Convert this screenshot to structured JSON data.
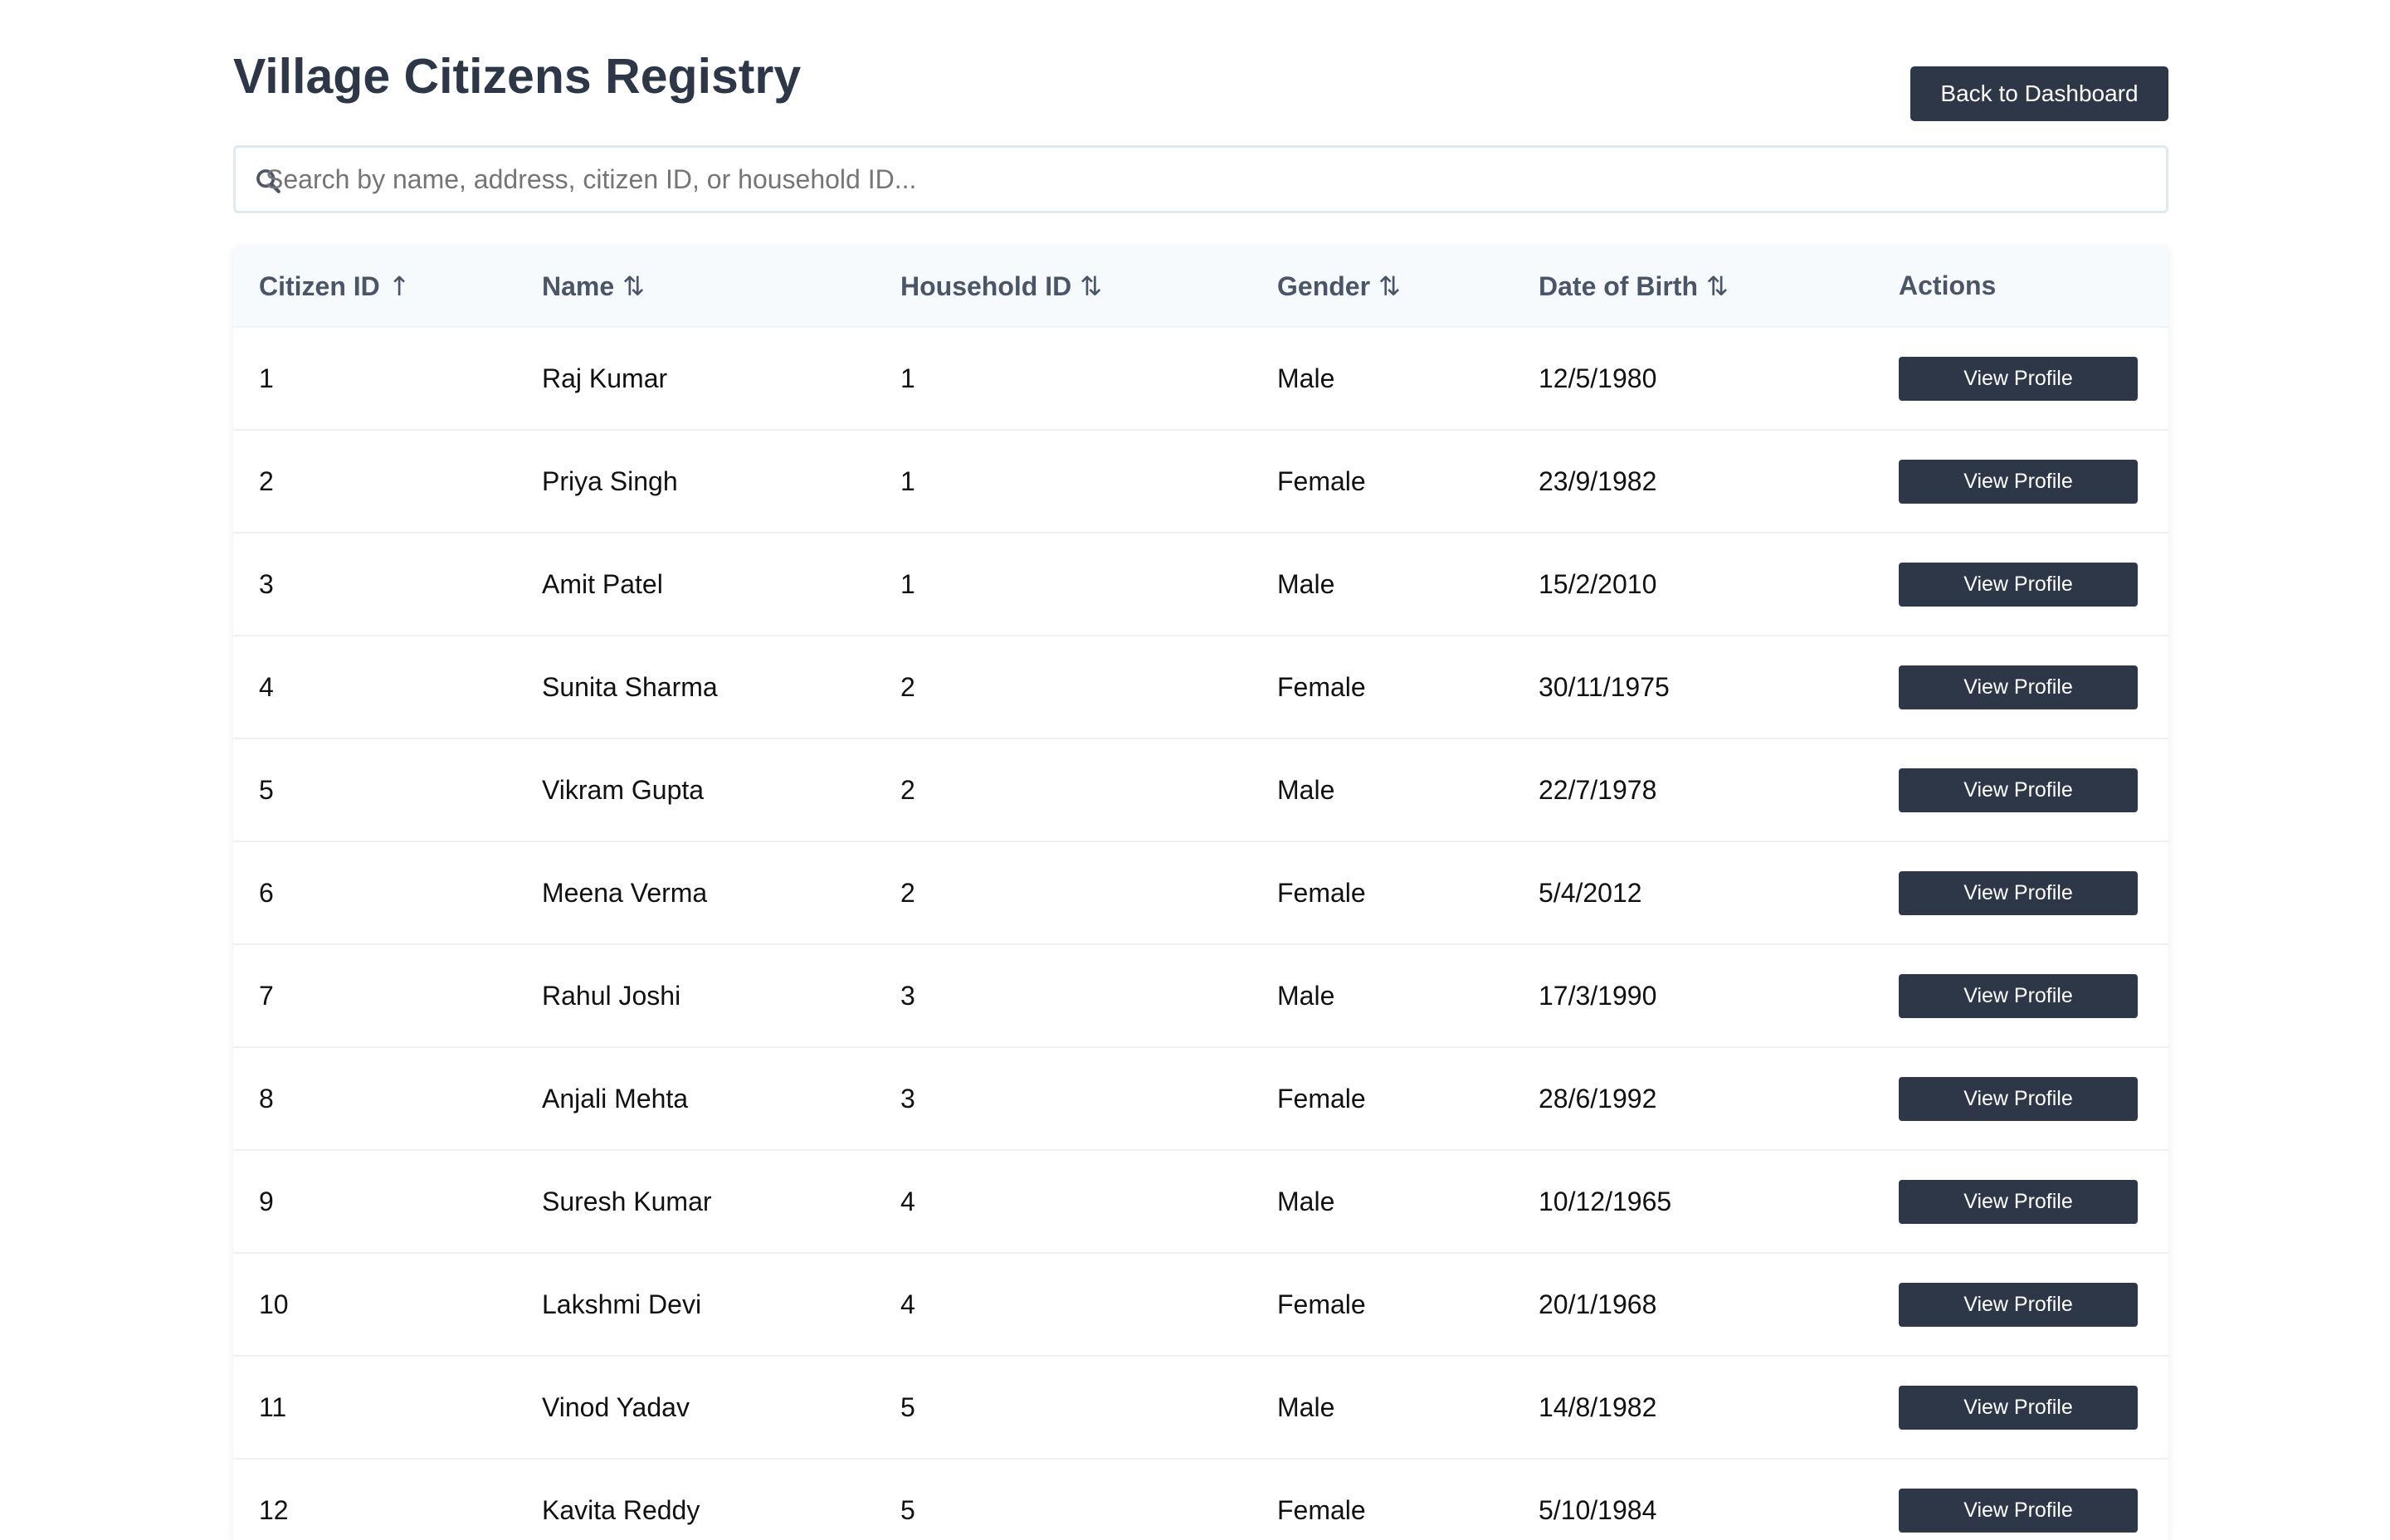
{
  "header": {
    "title": "Village Citizens Registry",
    "back_label": "Back to Dashboard"
  },
  "search": {
    "placeholder": "Search by name, address, citizen ID, or household ID...",
    "icon": "search-icon"
  },
  "table": {
    "columns": [
      {
        "label": "Citizen ID",
        "sort": "↑"
      },
      {
        "label": "Name",
        "sort": "⇅"
      },
      {
        "label": "Household ID",
        "sort": "⇅"
      },
      {
        "label": "Gender",
        "sort": "⇅"
      },
      {
        "label": "Date of Birth",
        "sort": "⇅"
      },
      {
        "label": "Actions",
        "sort": ""
      }
    ],
    "action_label": "View Profile",
    "rows": [
      {
        "id": "1",
        "name": "Raj Kumar",
        "household": "1",
        "gender": "Male",
        "dob": "12/5/1980"
      },
      {
        "id": "2",
        "name": "Priya Singh",
        "household": "1",
        "gender": "Female",
        "dob": "23/9/1982"
      },
      {
        "id": "3",
        "name": "Amit Patel",
        "household": "1",
        "gender": "Male",
        "dob": "15/2/2010"
      },
      {
        "id": "4",
        "name": "Sunita Sharma",
        "household": "2",
        "gender": "Female",
        "dob": "30/11/1975"
      },
      {
        "id": "5",
        "name": "Vikram Gupta",
        "household": "2",
        "gender": "Male",
        "dob": "22/7/1978"
      },
      {
        "id": "6",
        "name": "Meena Verma",
        "household": "2",
        "gender": "Female",
        "dob": "5/4/2012"
      },
      {
        "id": "7",
        "name": "Rahul Joshi",
        "household": "3",
        "gender": "Male",
        "dob": "17/3/1990"
      },
      {
        "id": "8",
        "name": "Anjali Mehta",
        "household": "3",
        "gender": "Female",
        "dob": "28/6/1992"
      },
      {
        "id": "9",
        "name": "Suresh Kumar",
        "household": "4",
        "gender": "Male",
        "dob": "10/12/1965"
      },
      {
        "id": "10",
        "name": "Lakshmi Devi",
        "household": "4",
        "gender": "Female",
        "dob": "20/1/1968"
      },
      {
        "id": "11",
        "name": "Vinod Yadav",
        "household": "5",
        "gender": "Male",
        "dob": "14/8/1982"
      },
      {
        "id": "12",
        "name": "Kavita Reddy",
        "household": "5",
        "gender": "Female",
        "dob": "5/10/1984"
      }
    ]
  },
  "colors": {
    "primary": "#2d3748",
    "header_bg": "#f7fafc",
    "border": "#e2e8f0"
  }
}
